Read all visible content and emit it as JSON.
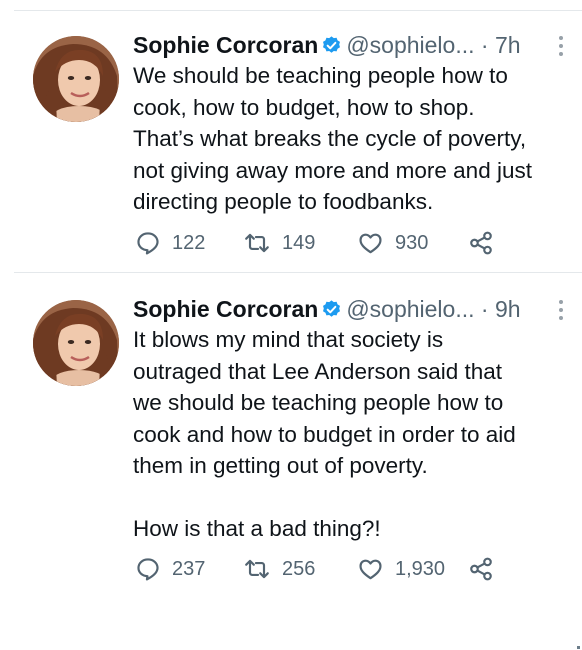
{
  "colors": {
    "verified_badge": "#1d9bf0",
    "secondary_text": "#536471",
    "primary_text": "#0f1419",
    "divider": "#e4e8eb"
  },
  "tweets": [
    {
      "author": {
        "name": "Sophie Corcoran",
        "handle": "@sophielo...",
        "verified": true,
        "avatar_icon": "avatar-photo"
      },
      "separator": "·",
      "time": "7h",
      "text": "We should be teaching people how to\ncook, how to budget, how to shop.\nThat’s what breaks the cycle of poverty,\nnot giving away more and more and just\ndirecting people to foodbanks.",
      "stats": {
        "replies": "122",
        "retweets": "149",
        "likes": "930"
      },
      "icons": [
        "reply-icon",
        "retweet-icon",
        "like-icon",
        "share-icon"
      ]
    },
    {
      "author": {
        "name": "Sophie Corcoran",
        "handle": "@sophielo...",
        "verified": true,
        "avatar_icon": "avatar-photo"
      },
      "separator": "·",
      "time": "9h",
      "text": "It blows my mind that society is\noutraged that Lee Anderson said that\nwe should be teaching people how to\ncook and how to budget in order to aid\nthem in getting out of poverty.\n\nHow is that a bad thing?!",
      "stats": {
        "replies": "237",
        "retweets": "256",
        "likes": "1,930"
      },
      "icons": [
        "reply-icon",
        "retweet-icon",
        "like-icon",
        "share-icon"
      ]
    }
  ]
}
